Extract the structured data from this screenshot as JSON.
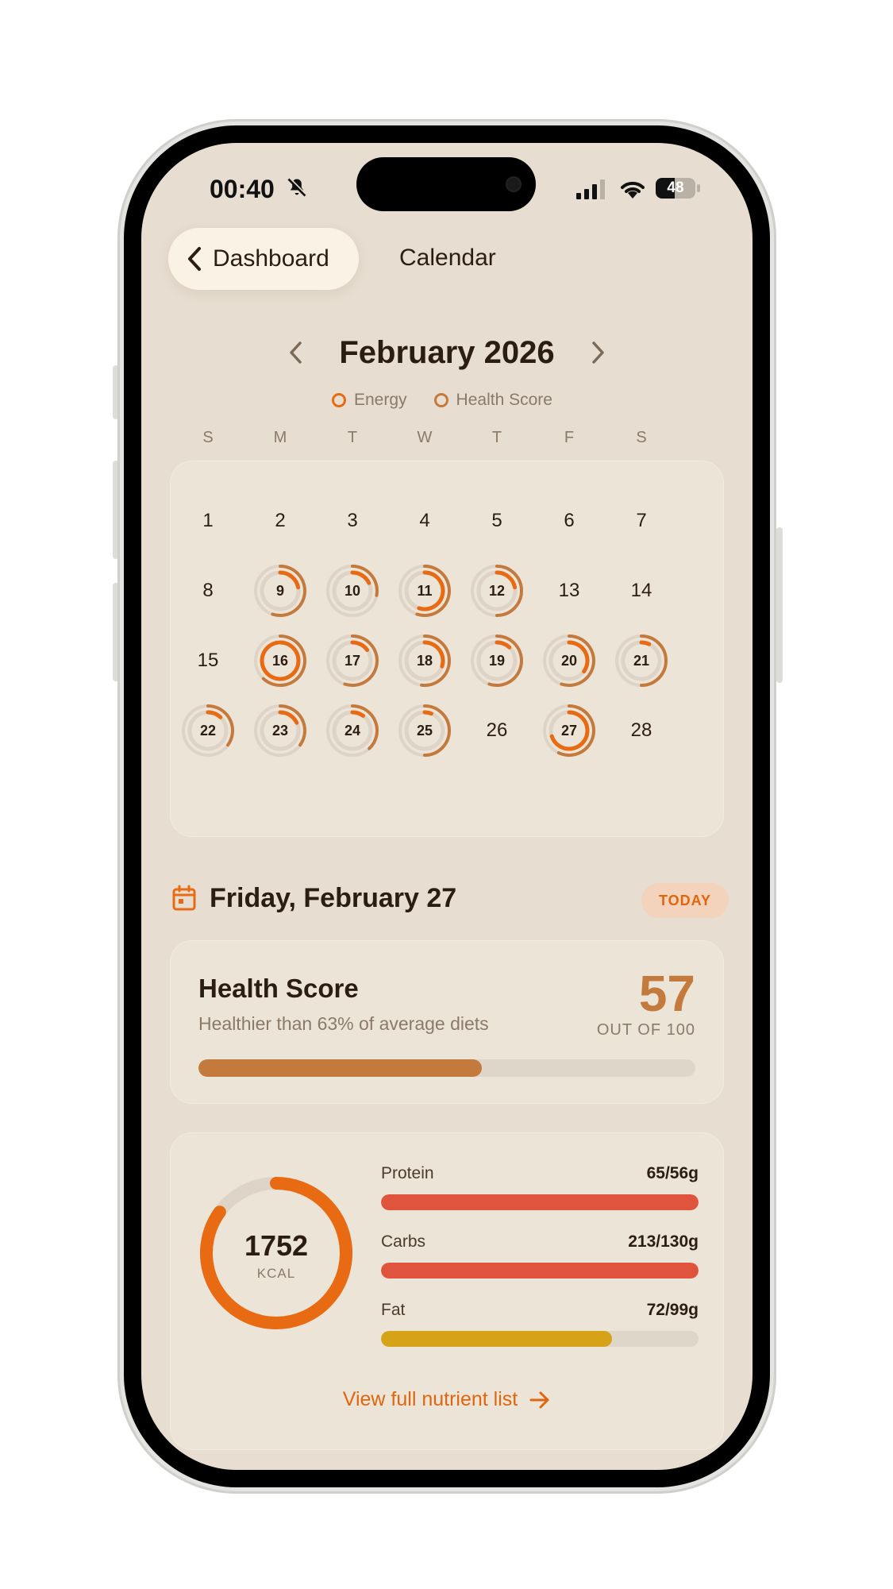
{
  "status": {
    "time": "00:40",
    "battery": "48"
  },
  "nav": {
    "back_label": "Dashboard",
    "title": "Calendar"
  },
  "calendar": {
    "month_title": "February 2026",
    "legend": [
      {
        "label": "Energy"
      },
      {
        "label": "Health Score"
      }
    ],
    "weekdays": [
      "S",
      "M",
      "T",
      "W",
      "T",
      "F",
      "S"
    ],
    "days": [
      {
        "d": "1",
        "energy": null,
        "health": null
      },
      {
        "d": "2",
        "energy": null,
        "health": null
      },
      {
        "d": "3",
        "energy": null,
        "health": null
      },
      {
        "d": "4",
        "energy": null,
        "health": null
      },
      {
        "d": "5",
        "energy": null,
        "health": null
      },
      {
        "d": "6",
        "energy": null,
        "health": null
      },
      {
        "d": "7",
        "energy": null,
        "health": null
      },
      {
        "d": "8",
        "energy": null,
        "health": null
      },
      {
        "d": "9",
        "energy": 0.22,
        "health": 0.55
      },
      {
        "d": "10",
        "energy": 0.18,
        "health": 0.28
      },
      {
        "d": "11",
        "energy": 0.55,
        "health": 0.55
      },
      {
        "d": "12",
        "energy": 0.22,
        "health": 0.5
      },
      {
        "d": "13",
        "energy": null,
        "health": null
      },
      {
        "d": "14",
        "energy": null,
        "health": null
      },
      {
        "d": "15",
        "energy": null,
        "health": null
      },
      {
        "d": "16",
        "energy": 0.98,
        "health": 0.62
      },
      {
        "d": "17",
        "energy": 0.15,
        "health": 0.55
      },
      {
        "d": "18",
        "energy": 0.3,
        "health": 0.52
      },
      {
        "d": "19",
        "energy": 0.12,
        "health": 0.55
      },
      {
        "d": "20",
        "energy": 0.35,
        "health": 0.55
      },
      {
        "d": "21",
        "energy": 0.07,
        "health": 0.5
      },
      {
        "d": "22",
        "energy": 0.12,
        "health": 0.35
      },
      {
        "d": "23",
        "energy": 0.18,
        "health": 0.35
      },
      {
        "d": "24",
        "energy": 0.1,
        "health": 0.38
      },
      {
        "d": "25",
        "energy": 0.06,
        "health": 0.5
      },
      {
        "d": "26",
        "energy": null,
        "health": null
      },
      {
        "d": "27",
        "energy": 0.7,
        "health": 0.57
      },
      {
        "d": "28",
        "energy": null,
        "health": null
      }
    ]
  },
  "selected": {
    "date_title": "Friday, February 27",
    "badge": "TODAY"
  },
  "health_score": {
    "title": "Health Score",
    "subtitle": "Healthier than 63% of average diets",
    "score": "57",
    "out_of": "OUT OF 100",
    "fraction": 0.57
  },
  "nutrition": {
    "kcal": "1752",
    "kcal_unit": "KCAL",
    "kcal_fraction": 0.85,
    "items": [
      {
        "label": "Protein",
        "value": "65/56g",
        "fraction": 1.0,
        "color": "#e0533c"
      },
      {
        "label": "Carbs",
        "value": "213/130g",
        "fraction": 1.0,
        "color": "#e0533c"
      },
      {
        "label": "Fat",
        "value": "72/99g",
        "fraction": 0.727,
        "color": "#d6a218"
      }
    ],
    "link": "View full nutrient list"
  },
  "colors": {
    "energy": "#e86a12",
    "health": "#c47a3c",
    "ring_track": "#ddd3c6"
  }
}
